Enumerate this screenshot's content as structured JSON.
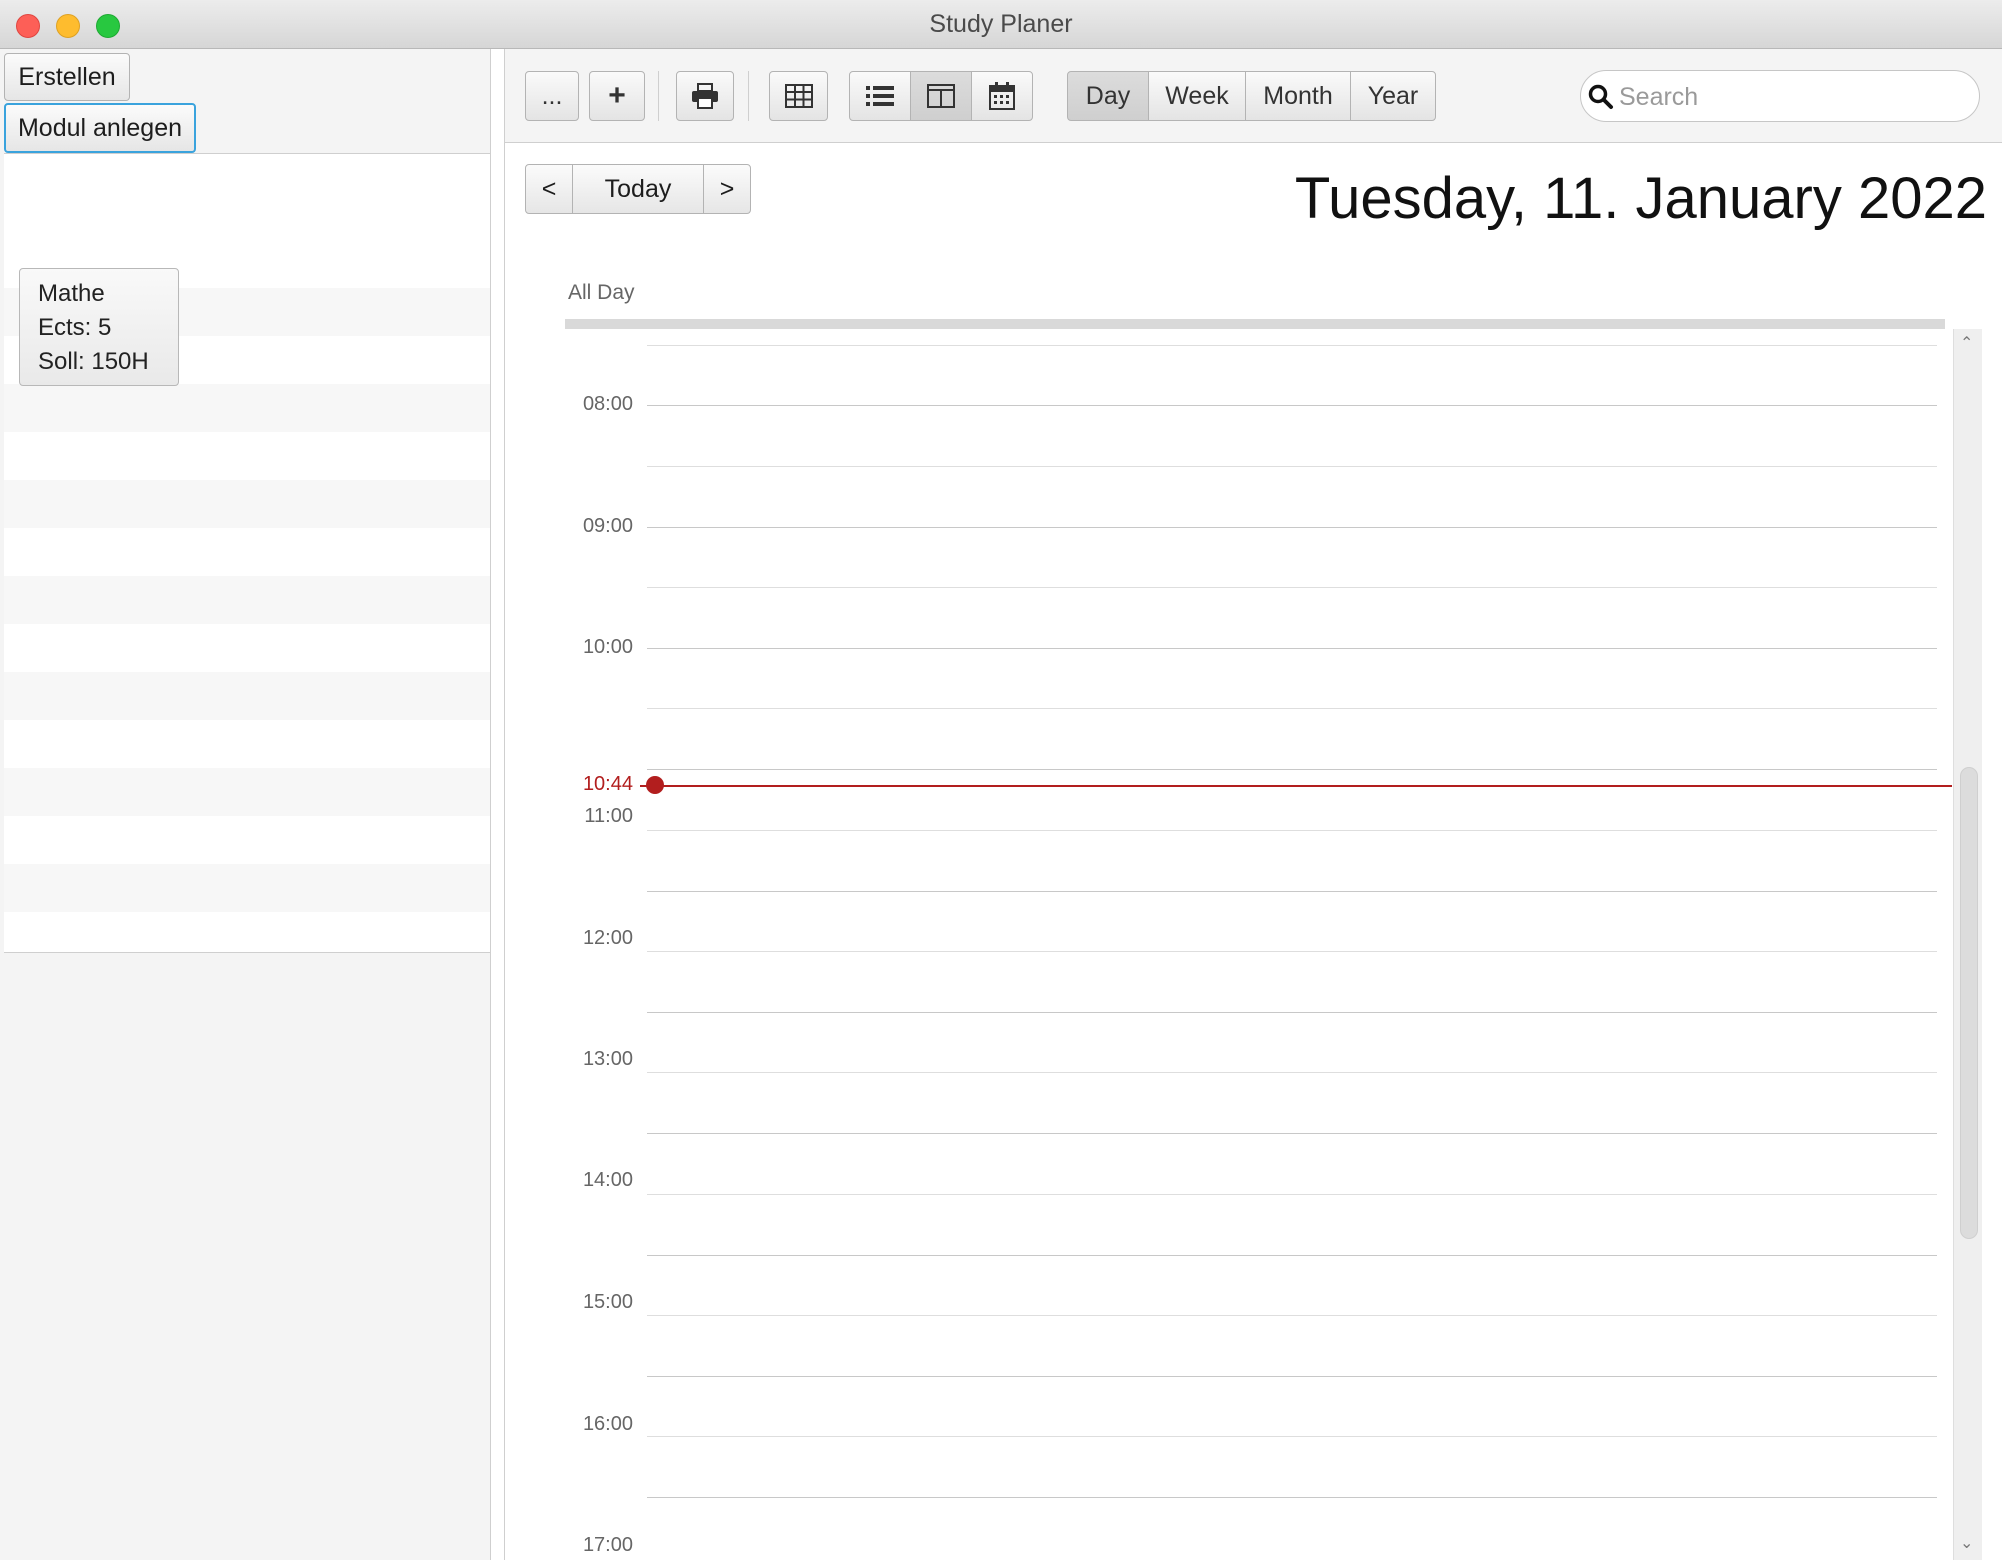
{
  "window": {
    "title": "Study Planer"
  },
  "sidebar": {
    "create_button": "Erstellen",
    "add_module_button": "Modul anlegen",
    "modules": [
      {
        "name": "Mathe",
        "ects": "Ects: 5",
        "soll": "Soll: 150H"
      }
    ]
  },
  "toolbar": {
    "more_label": "...",
    "add_label": "+",
    "view_buttons": [
      "Day",
      "Week",
      "Month",
      "Year"
    ],
    "selected_view": "Day",
    "search_placeholder": "Search",
    "icons": [
      "more-icon",
      "add-icon",
      "print-icon",
      "table-icon",
      "list-icon",
      "split-icon",
      "calendar-icon",
      "search-icon"
    ]
  },
  "nav": {
    "prev": "<",
    "today": "Today",
    "next": ">"
  },
  "date_title": "Tuesday, 11. January 2022",
  "calendar": {
    "all_day_label": "All Day",
    "hours": [
      "08:00",
      "09:00",
      "10:00",
      "11:00",
      "12:00",
      "13:00",
      "14:00",
      "15:00",
      "16:00",
      "17:00"
    ],
    "current_time": "10:44",
    "accent_color": "#b21e1e"
  }
}
